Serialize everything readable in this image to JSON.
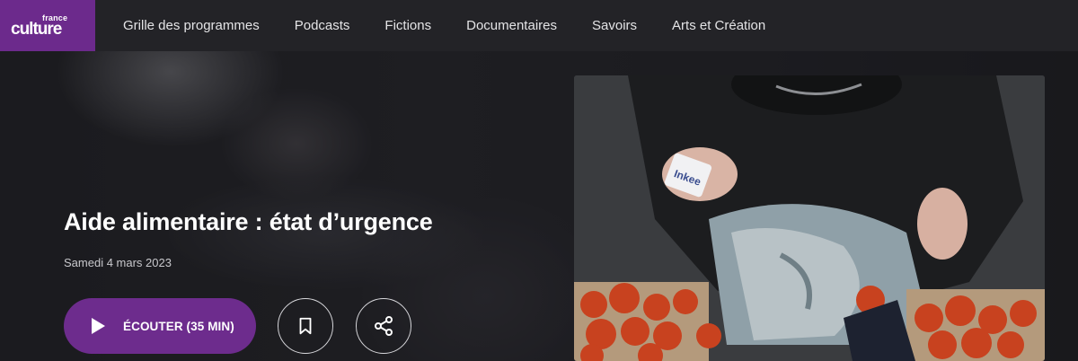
{
  "brand": {
    "logo_small": "france",
    "logo_big": "culture",
    "accent_color": "#6c2a8c"
  },
  "nav": {
    "items": [
      {
        "label": "Grille des programmes"
      },
      {
        "label": "Podcasts"
      },
      {
        "label": "Fictions"
      },
      {
        "label": "Documentaires"
      },
      {
        "label": "Savoirs"
      },
      {
        "label": "Arts et Création"
      }
    ]
  },
  "episode": {
    "title": "Aide alimentaire : état d’urgence",
    "date": "Samedi 4 mars 2023",
    "listen_label": "ÉCOUTER (35 MIN)",
    "icons": {
      "play": "play-icon",
      "bookmark": "bookmark-icon",
      "share": "share-icon"
    }
  }
}
